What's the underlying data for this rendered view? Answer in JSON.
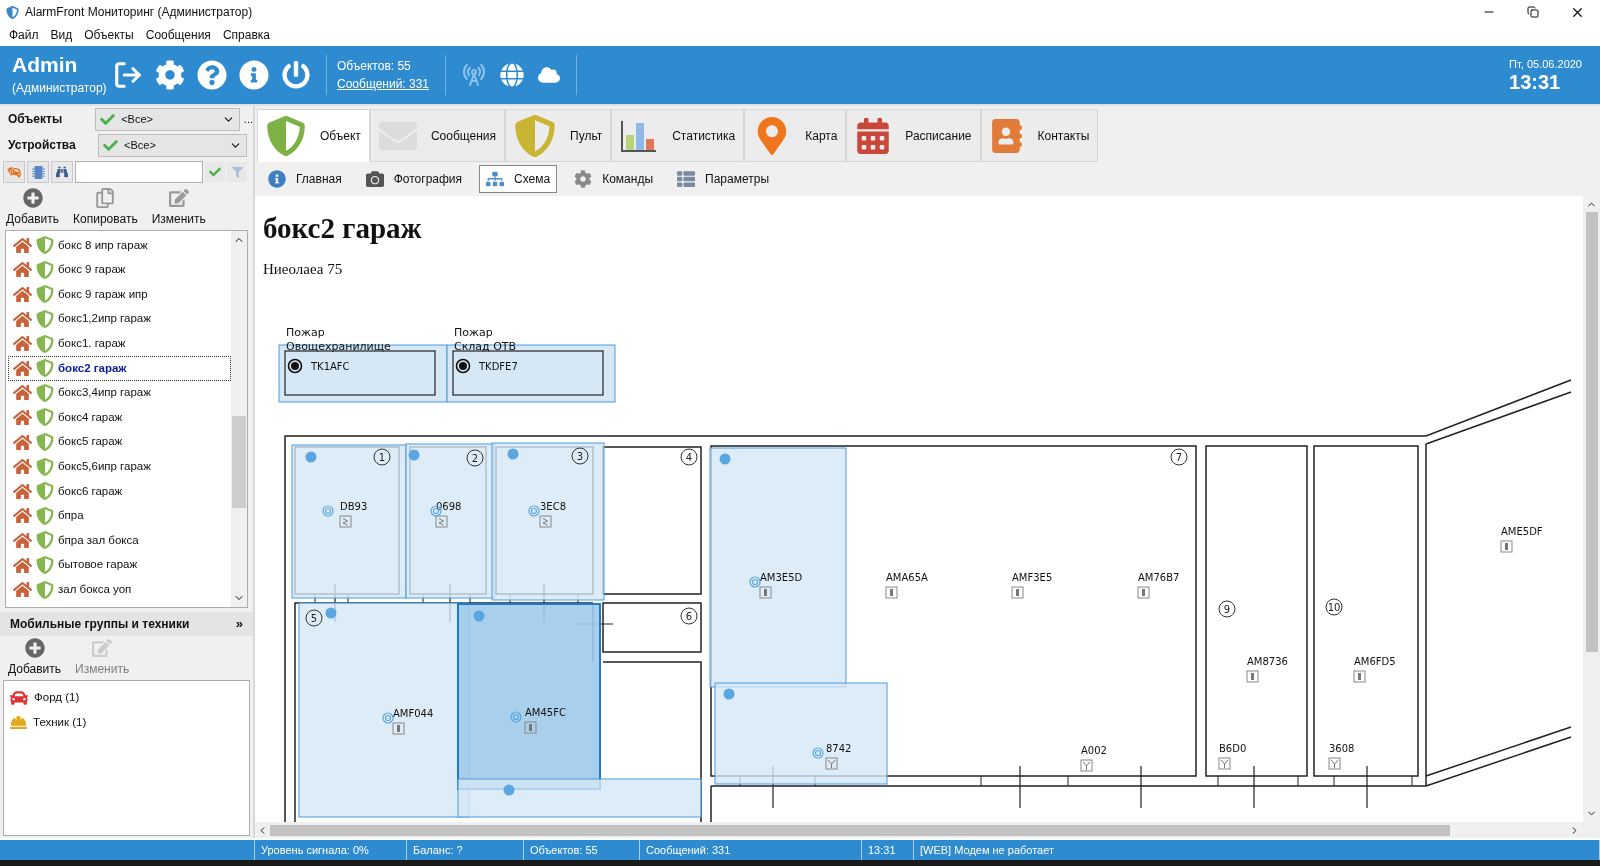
{
  "window": {
    "title": "AlarmFront Мониторинг (Администратор)"
  },
  "menu": [
    "Файл",
    "Вид",
    "Объекты",
    "Сообщения",
    "Справка"
  ],
  "header": {
    "user": "Admin",
    "role": "(Администратор)",
    "objects_count": "Объектов: 55",
    "messages_link": "Сообщений: 331",
    "date": "Пт, 05.06.2020",
    "time": "13:31"
  },
  "filters": [
    {
      "label": "Объекты",
      "value": "<Все>",
      "more": "..."
    },
    {
      "label": "Устройства",
      "value": "<Все>"
    }
  ],
  "object_actions": [
    {
      "label": "Добавить",
      "disabled": false
    },
    {
      "label": "Копировать",
      "disabled": false
    },
    {
      "label": "Изменить",
      "disabled": false
    }
  ],
  "objects": [
    {
      "name": "бокс 8 ипр гараж",
      "selected": false
    },
    {
      "name": "бокс 9 гараж",
      "selected": false
    },
    {
      "name": "бокс 9 гараж ипр",
      "selected": false
    },
    {
      "name": "бокс1,2ипр гараж",
      "selected": false
    },
    {
      "name": "бокс1. гараж",
      "selected": false
    },
    {
      "name": "бокс2 гараж",
      "selected": true
    },
    {
      "name": "бокс3,4ипр гараж",
      "selected": false
    },
    {
      "name": "бокс4 гараж",
      "selected": false
    },
    {
      "name": "бокс5 гараж",
      "selected": false
    },
    {
      "name": "бокс5,6ипр гараж",
      "selected": false
    },
    {
      "name": "бокс6 гараж",
      "selected": false
    },
    {
      "name": "бпра",
      "selected": false
    },
    {
      "name": "бпра зал бокса",
      "selected": false
    },
    {
      "name": "бытовое гараж",
      "selected": false
    },
    {
      "name": "зал бокса уоп",
      "selected": false
    }
  ],
  "mobile": {
    "title": "Мобильные группы и техники",
    "more": "»",
    "actions": [
      {
        "label": "Добавить",
        "disabled": false
      },
      {
        "label": "Изменить",
        "disabled": true
      }
    ],
    "items": [
      {
        "kind": "car",
        "name": "Форд (1)"
      },
      {
        "kind": "worker",
        "name": "Техник (1)"
      }
    ]
  },
  "tabs": [
    {
      "label": "Объект",
      "selected": true
    },
    {
      "label": "Сообщения",
      "selected": false
    },
    {
      "label": "Пульт",
      "selected": false
    },
    {
      "label": "Статистика",
      "selected": false
    },
    {
      "label": "Карта",
      "selected": false
    },
    {
      "label": "Расписание",
      "selected": false
    },
    {
      "label": "Контакты",
      "selected": false
    }
  ],
  "subtabs": [
    {
      "label": "Главная",
      "selected": false
    },
    {
      "label": "Фотография",
      "selected": false
    },
    {
      "label": "Схема",
      "selected": true
    },
    {
      "label": "Команды",
      "selected": false
    },
    {
      "label": "Параметры",
      "selected": false
    }
  ],
  "object": {
    "title": "бокс2 гараж",
    "address": "Ниеолаеа 75"
  },
  "plan": {
    "fire_zones": [
      {
        "caption": "Пожар",
        "zone": "Овощехранилище",
        "device": "TK1AFC"
      },
      {
        "caption": "Пожар",
        "zone": "Склад ОТВ",
        "device": "TKDFE7"
      }
    ],
    "rooms": [
      "1",
      "2",
      "3",
      "4",
      "5",
      "6",
      "7",
      "9",
      "10"
    ],
    "zones": [
      {
        "selected": false
      },
      {
        "selected": false
      },
      {
        "selected": false
      },
      {
        "selected": false
      },
      {
        "selected": true
      },
      {
        "selected": false
      },
      {
        "selected": false
      },
      {
        "selected": false
      }
    ],
    "sensors": [
      {
        "id": "DB93",
        "kind": "leak"
      },
      {
        "id": "0698",
        "kind": "leak"
      },
      {
        "id": "3EC8",
        "kind": "leak"
      },
      {
        "id": "AMF044",
        "kind": "motion"
      },
      {
        "id": "AM45FC",
        "kind": "motion"
      },
      {
        "id": "AM3E5D",
        "kind": "motion"
      },
      {
        "id": "8742",
        "kind": "smoke"
      },
      {
        "id": "AMA65A",
        "kind": "motion"
      },
      {
        "id": "AMF3E5",
        "kind": "motion"
      },
      {
        "id": "AM76B7",
        "kind": "motion"
      },
      {
        "id": "AM8736",
        "kind": "motion"
      },
      {
        "id": "AM6FD5",
        "kind": "motion"
      },
      {
        "id": "AME5DF",
        "kind": "motion"
      },
      {
        "id": "A002",
        "kind": "smoke"
      },
      {
        "id": "B6D0",
        "kind": "smoke"
      },
      {
        "id": "3608",
        "kind": "smoke"
      }
    ]
  },
  "status_bar": [
    "Уровень сигнала: 0%",
    "Баланс: ?",
    "Объектов: 55",
    "Сообщений: 331",
    "13:31",
    "[WEB] Модем не работает"
  ]
}
